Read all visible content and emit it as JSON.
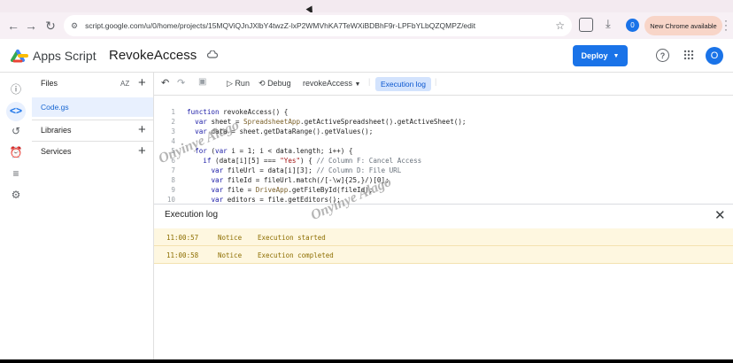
{
  "browser": {
    "url": "script.google.com/u/0/home/projects/15MQViQJnJXlbY4twzZ-lxP2WMVhKA7TeWXiBDBhF9r-LPFbYLbQZQMPZ/edit",
    "profile_initial": "0",
    "new_chrome_label": "New Chrome available"
  },
  "app": {
    "name": "Apps Script",
    "project": "RevokeAccess",
    "deploy_label": "Deploy",
    "avatar_initial": "O"
  },
  "sidebar": {
    "files_label": "Files",
    "sort_label": "AZ",
    "file_name": "Code.gs",
    "libraries_label": "Libraries",
    "services_label": "Services"
  },
  "toolbar": {
    "run_label": "Run",
    "debug_label": "Debug",
    "function_name": "revokeAccess",
    "execution_log_label": "Execution log"
  },
  "code_lines": [
    {
      "n": "1",
      "text": "function revokeAccess() {"
    },
    {
      "n": "2",
      "text": "  var sheet = SpreadsheetApp.getActiveSpreadsheet().getActiveSheet();"
    },
    {
      "n": "3",
      "text": "  var data = sheet.getDataRange().getValues();"
    },
    {
      "n": "4",
      "text": ""
    },
    {
      "n": "5",
      "text": "  for (var i = 1; i < data.length; i++) {"
    },
    {
      "n": "6",
      "text": "    if (data[i][5] === \"Yes\") { // Column F: Cancel Access"
    },
    {
      "n": "7",
      "text": "      var fileUrl = data[i][3]; // Column D: File URL"
    },
    {
      "n": "8",
      "text": "      var fileId = fileUrl.match(/[-\\w]{25,}/)[0];"
    },
    {
      "n": "9",
      "text": "      var file = DriveApp.getFileById(fileId);"
    },
    {
      "n": "10",
      "text": "      var editors = file.getEditors();"
    }
  ],
  "execution_log": {
    "title": "Execution log",
    "entries": [
      {
        "time": "11:00:57",
        "level": "Notice",
        "message": "Execution started"
      },
      {
        "time": "11:00:58",
        "level": "Notice",
        "message": "Execution completed"
      }
    ]
  },
  "watermark": "Onyinye Alago",
  "colors": {
    "accent": "#1a73e8",
    "log_bg": "#fef7e0",
    "log_text": "#8d6e00"
  }
}
